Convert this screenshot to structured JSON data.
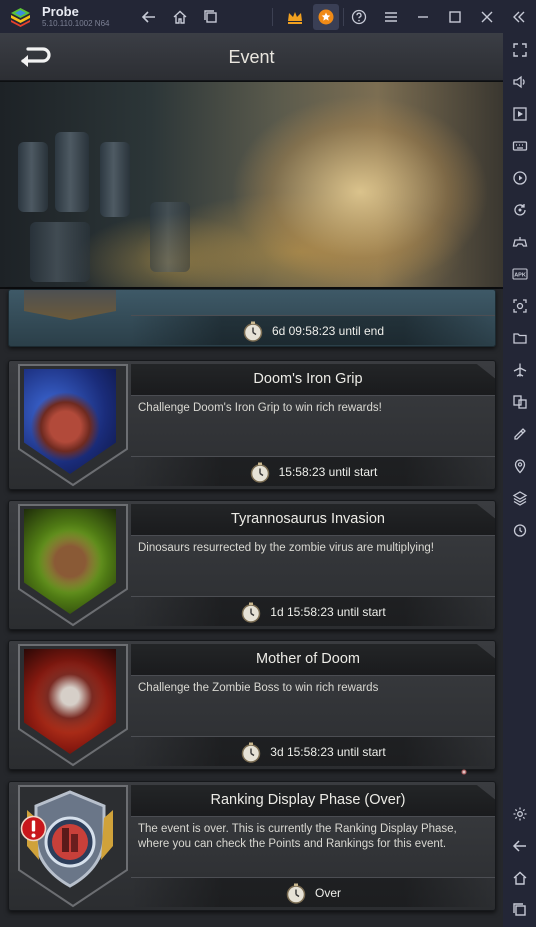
{
  "window": {
    "app_name": "Probe",
    "version": "5.10.110.1002 N64",
    "icons": [
      "back-icon",
      "home-icon",
      "recent-apps-icon",
      "crown-icon",
      "star-badge-icon",
      "help-icon",
      "menu-icon",
      "minimize-icon",
      "maximize-icon",
      "close-icon",
      "collapse-sidebar-icon"
    ]
  },
  "sidebar": {
    "items": [
      "fullscreen-icon",
      "volume-icon",
      "screen-record-icon",
      "keyboard-icon",
      "macro-icon",
      "sync-icon",
      "controller-icon",
      "apk-icon",
      "screenshot-icon",
      "folder-icon",
      "airplane-icon",
      "multi-instance-icon",
      "eco-mode-icon",
      "location-icon",
      "layers-icon",
      "timer-icon",
      "settings-icon",
      "android-back-icon",
      "android-home-icon",
      "android-recents-icon"
    ],
    "apk_label": "APK"
  },
  "header": {
    "title": "Event"
  },
  "events": [
    {
      "title": "",
      "description": "",
      "timer": "6d 09:58:23 until end"
    },
    {
      "title": "Doom's Iron Grip",
      "description": "Challenge Doom's Iron Grip to win rich rewards!",
      "timer": "15:58:23 until start"
    },
    {
      "title": "Tyrannosaurus Invasion",
      "description": "Dinosaurs resurrected by the zombie virus are multiplying!",
      "timer": "1d 15:58:23 until start"
    },
    {
      "title": "Mother of Doom",
      "description": "Challenge the Zombie Boss to win rich rewards",
      "timer": "3d 15:58:23 until start"
    },
    {
      "title": "Ranking Display Phase (Over)",
      "description": "The event is over. This is currently the Ranking Display Phase, where you can check the Points and Rankings for this event.",
      "timer": "Over"
    }
  ],
  "colors": {
    "accent_orange": "#f08a16",
    "alert_red": "#c8171c",
    "titlebar": "#232636"
  }
}
